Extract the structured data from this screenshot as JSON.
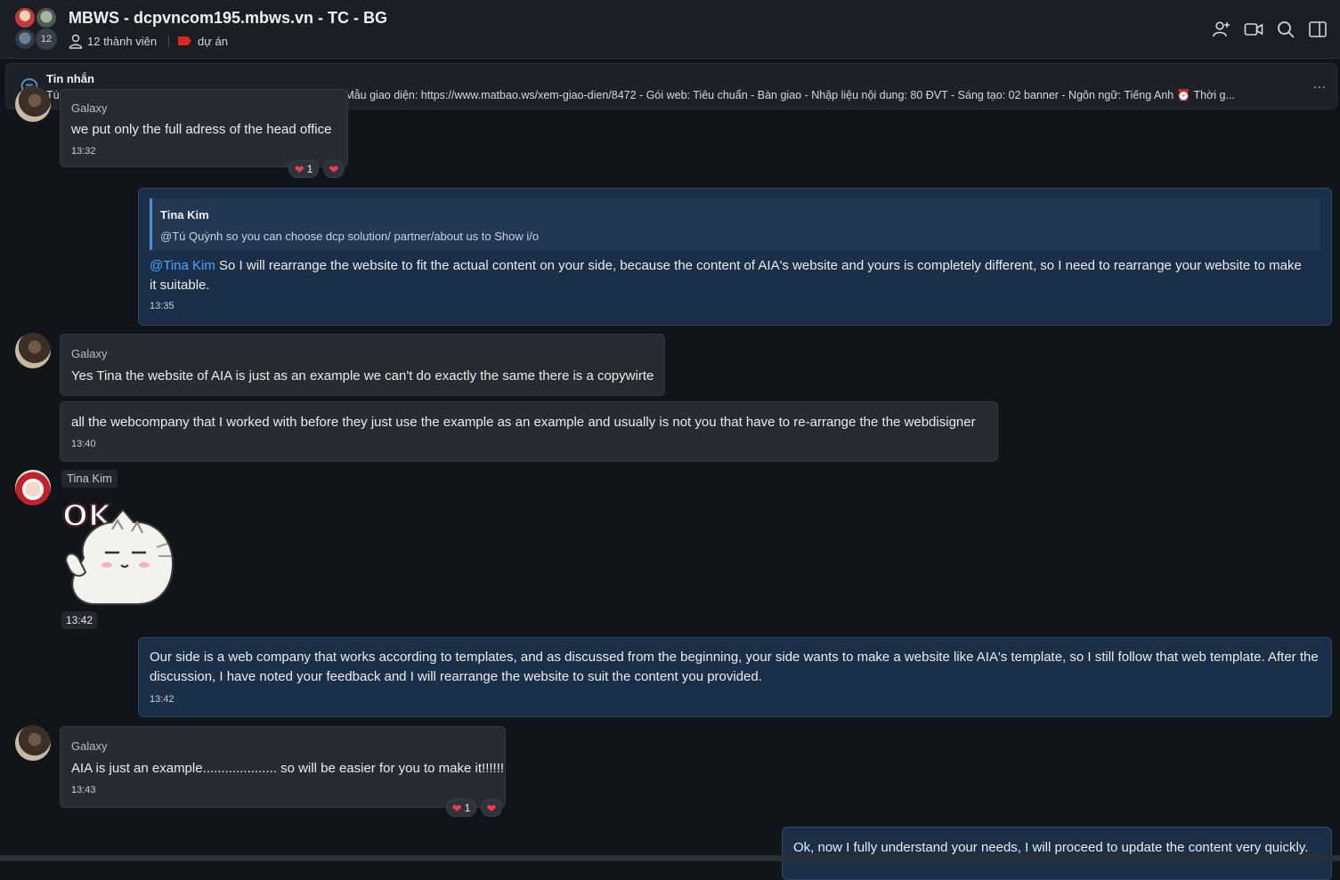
{
  "header": {
    "title": "MBWS - dcpvncom195.mbws.vn - TC - BG",
    "member_count_badge": "12",
    "members_label": "12 thành viên",
    "tag_label": "dự án",
    "tag_color": "#e02424",
    "icons": [
      "add-member-icon",
      "video-call-icon",
      "search-icon",
      "toggle-sidebar-icon"
    ]
  },
  "pinned": {
    "title": "Tin nhắn",
    "text": "Tú Quỳnh: - Tên miền tạm: https://dcpvncom195.mbws.vn/ - Mẫu giao diện: https://www.matbao.ws/xem-giao-dien/8472 - Gói web: Tiêu chuẩn - Bàn giao - Nhập liệu nội dung: 80 ĐVT - Sáng tạo: 02 banner - Ngôn ngữ: Tiếng Anh ⏰ Thời g...",
    "more": "..."
  },
  "messages": {
    "m1": {
      "sender": "Galaxy",
      "text": "we put only the full adress of the head office",
      "time": "13:32",
      "reaction_count": "1"
    },
    "m2": {
      "quote_name": "Tina Kim",
      "quote_text": "@Tú Quỳnh so you can choose dcp solution/ partner/about us to Show i/o",
      "mention": "@Tina Kim",
      "text": " So I will rearrange the website to fit the actual content on your side, because the content of AIA's website and yours is completely different, so I need to rearrange your website to make it suitable.",
      "time": "13:35"
    },
    "m3": {
      "sender": "Galaxy",
      "text": "Yes Tina the website of AIA is just as an example we can't do exactly the same there is a copywirte"
    },
    "m4": {
      "text": "all the webcompany that I worked with before they just use the example as an example and usually is not you that have to re-arrange the the webdisigner",
      "time": "13:40"
    },
    "m5": {
      "sender": "Tina Kim",
      "sticker_text": "OK",
      "time": "13:42"
    },
    "m6": {
      "text": "Our side is a web company that works according to templates, and as discussed from the beginning, your side wants to make a website like AIA's template, so I still follow that web template. After the discussion, I have noted your feedback and I will rearrange the website to suit the content you provided.",
      "time": "13:42"
    },
    "m7": {
      "sender": "Galaxy",
      "text": "AIA is just an example.................... so will be easier for you to make it!!!!!!",
      "time": "13:43",
      "reaction_count": "1"
    },
    "m8": {
      "text": "Ok, now I fully understand your needs, I will proceed to update the content very quickly."
    }
  },
  "colors": {
    "background": "#111418",
    "incoming_bubble": "#272b32",
    "outgoing_bubble": "#1c2f48",
    "mention": "#4ea3ff",
    "heart": "#ff3b4a"
  }
}
